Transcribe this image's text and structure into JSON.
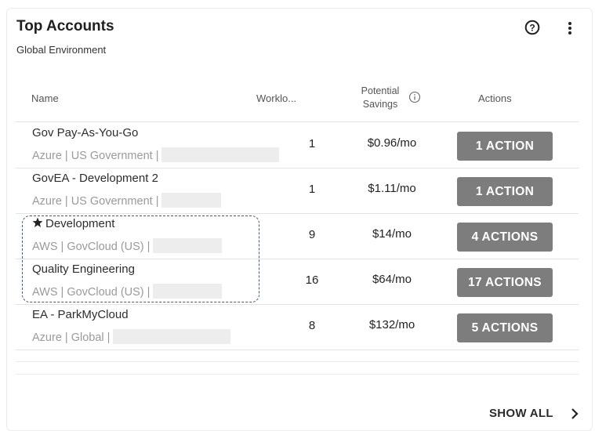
{
  "widget": {
    "title": "Top Accounts",
    "subtitle": "Global Environment",
    "help_icon": "question-circle-icon",
    "menu_icon": "kebab-vertical-icon"
  },
  "table": {
    "columns": {
      "name": "Name",
      "workloads": "Worklo...",
      "potential_savings_line1": "Potential",
      "potential_savings_line2": "Savings",
      "actions": "Actions"
    },
    "rows": [
      {
        "name": "Gov Pay-As-You-Go",
        "starred": false,
        "sub": "Azure | US Government |",
        "workloads": "1",
        "savings": "$0.96/mo",
        "action": "1 ACTION"
      },
      {
        "name": "GovEA - Development 2",
        "starred": false,
        "sub": "Azure | US Government |",
        "workloads": "1",
        "savings": "$1.11/mo",
        "action": "1 ACTION"
      },
      {
        "name": "Development",
        "starred": true,
        "sub": "AWS | GovCloud (US) |",
        "workloads": "9",
        "savings": "$14/mo",
        "action": "4 ACTIONS"
      },
      {
        "name": "Quality Engineering",
        "starred": false,
        "sub": "AWS | GovCloud (US) |",
        "workloads": "16",
        "savings": "$64/mo",
        "action": "17 ACTIONS"
      },
      {
        "name": "EA - ParkMyCloud",
        "starred": false,
        "sub": "Azure | Global |",
        "workloads": "8",
        "savings": "$132/mo",
        "action": "5 ACTIONS"
      }
    ]
  },
  "footer": {
    "show_all": "SHOW ALL"
  },
  "colors": {
    "action_button_bg": "#7d7d7d",
    "highlight_border": "#4a5a6a"
  }
}
